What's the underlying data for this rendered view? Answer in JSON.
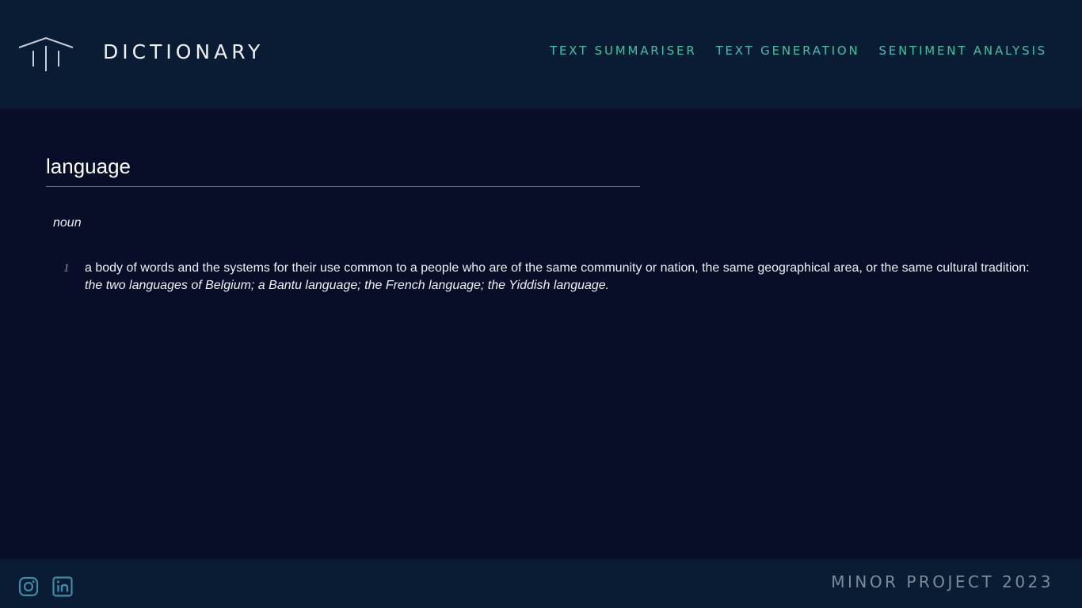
{
  "header": {
    "logo_icon": "columns-logo-icon",
    "brand": "DICTIONARY",
    "nav": [
      {
        "label": "TEXT SUMMARISER"
      },
      {
        "label": "TEXT GENERATION"
      },
      {
        "label": "SENTIMENT ANALYSIS"
      }
    ]
  },
  "entry": {
    "word": "language",
    "part_of_speech": "noun",
    "definitions": [
      {
        "number": "1",
        "text": "a body of words and the systems for their use common to a people who are of the same community or nation, the same geographical area, or the same cultural tradition:",
        "example": "the two languages of Belgium; a Bantu language; the French language; the Yiddish language."
      }
    ]
  },
  "footer": {
    "social": [
      {
        "icon": "instagram-icon"
      },
      {
        "icon": "linkedin-icon"
      }
    ],
    "copyright": "MINOR PROJECT 2023"
  },
  "colors": {
    "background": "#080d28",
    "header_bg": "#0a1c33",
    "accent": "#3fc1a6",
    "footer_text": "#7d8b99"
  }
}
